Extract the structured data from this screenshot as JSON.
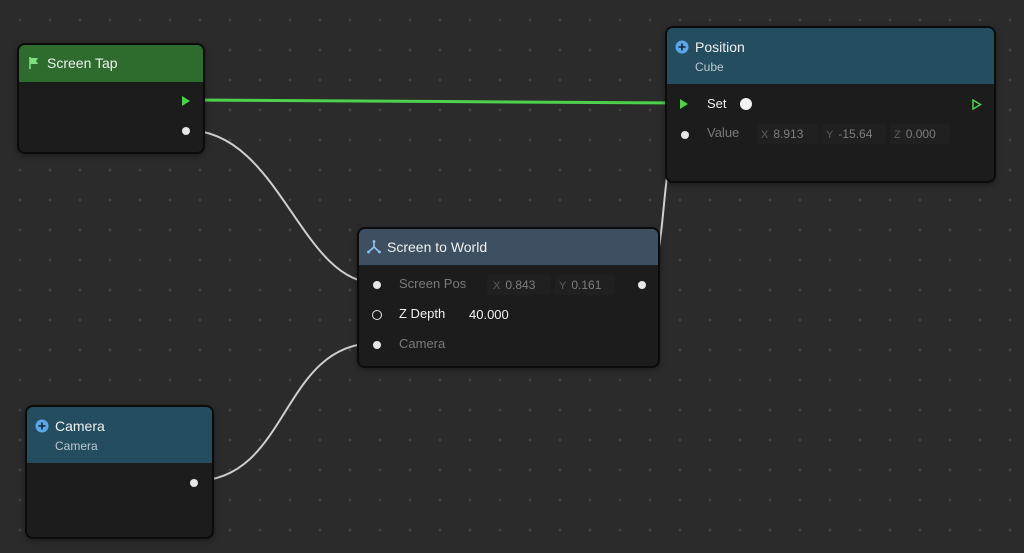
{
  "canvas": {
    "background": "#2b2b2b"
  },
  "colors": {
    "event_header": "#2e6b2e",
    "object_header": "#244e60",
    "function_header": "#3d4f60",
    "exec_wire": "#4cd14c",
    "data_wire": "#cfcfcf"
  },
  "nodes": {
    "screen_tap": {
      "title": "Screen Tap",
      "icon": "flag-icon"
    },
    "position": {
      "title": "Position",
      "subtitle": "Cube",
      "icon": "plus-circle-icon",
      "set_label": "Set",
      "value_label": "Value",
      "value": {
        "x_axis": "X",
        "x": "8.913",
        "y_axis": "Y",
        "y": "-15.64",
        "z_axis": "Z",
        "z": "0.000"
      }
    },
    "screen_to_world": {
      "title": "Screen to World",
      "icon": "axes-icon",
      "screen_pos_label": "Screen Pos",
      "screen_pos": {
        "x_axis": "X",
        "x": "0.843",
        "y_axis": "Y",
        "y": "0.161"
      },
      "z_depth_label": "Z Depth",
      "z_depth": "40.000",
      "camera_label": "Camera"
    },
    "camera": {
      "title": "Camera",
      "subtitle": "Camera",
      "icon": "plus-circle-icon"
    }
  }
}
